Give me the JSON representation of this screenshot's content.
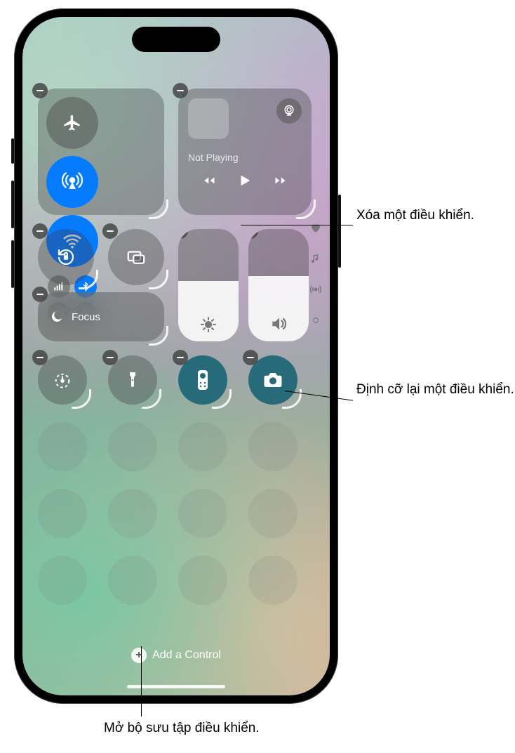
{
  "media": {
    "not_playing": "Not Playing"
  },
  "focus": {
    "label": "Focus"
  },
  "add_control": {
    "label": "Add a Control"
  },
  "sliders": {
    "brightness_fill_pct": 54,
    "volume_fill_pct": 58
  },
  "icons": {
    "airplane": "airplane-icon",
    "airdrop": "airdrop-icon",
    "wifi": "wifi-icon",
    "cellular": "cellular-bars-icon",
    "bluetooth": "bluetooth-icon",
    "hotspot": "personal-hotspot-icon",
    "satellite": "satellite-icon",
    "airplay": "airplay-icon",
    "rewind": "rewind-icon",
    "play": "play-icon",
    "forward": "forward-icon",
    "rotation_lock": "rotation-lock-icon",
    "screen_mirroring": "screen-mirroring-icon",
    "moon": "moon-icon",
    "brightness": "brightness-icon",
    "volume": "volume-icon",
    "heart": "heart-icon",
    "music_note": "music-note-icon",
    "broadcast": "broadcast-icon",
    "dot": "page-dot-icon",
    "timer": "timer-icon",
    "flashlight": "flashlight-icon",
    "remote": "apple-tv-remote-icon",
    "camera": "camera-icon",
    "plus": "plus-icon",
    "remove": "remove-icon",
    "resize": "resize-handle-icon"
  },
  "callouts": {
    "remove": "Xóa một điều khiển.",
    "resize": "Định cỡ lại một điều khiển.",
    "gallery": "Mở bộ sưu tập điều khiển."
  }
}
